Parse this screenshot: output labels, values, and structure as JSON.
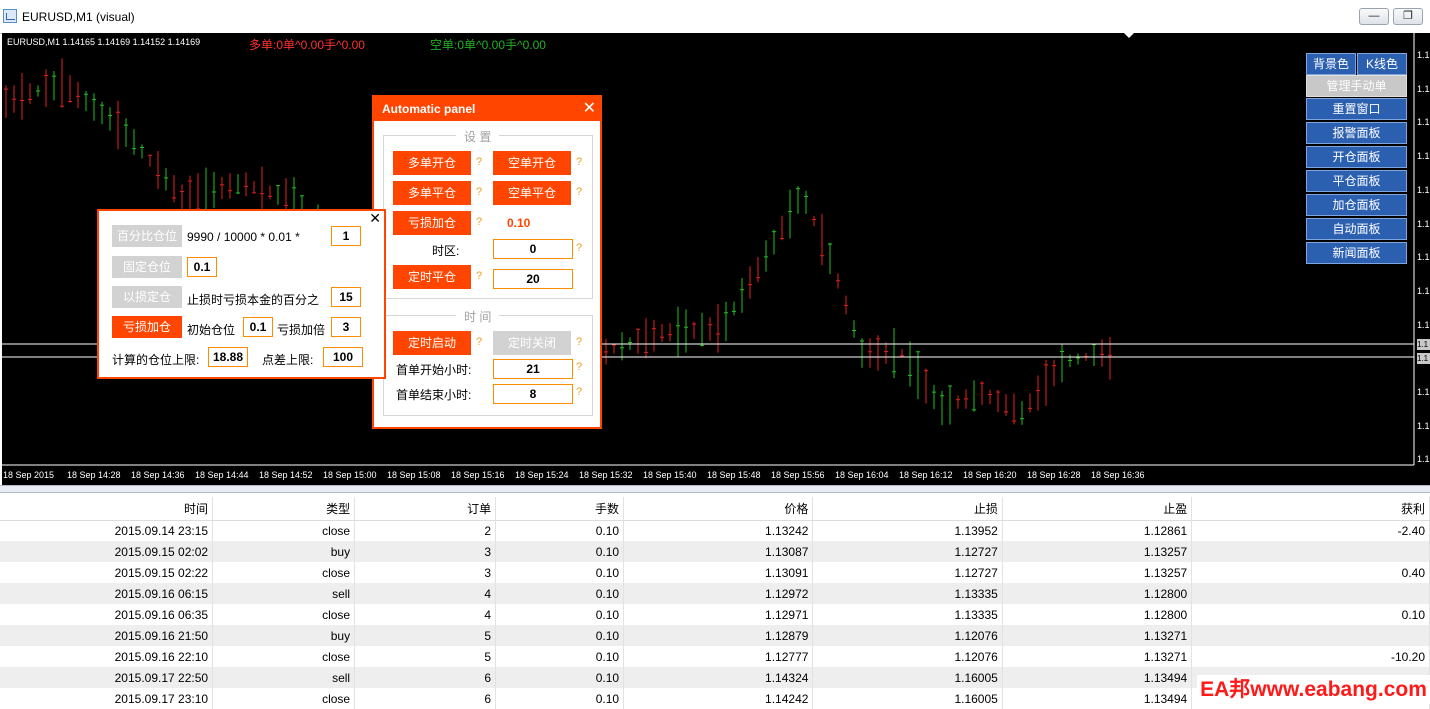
{
  "window": {
    "title": "EURUSD,M1 (visual)",
    "btn_minimize": "—",
    "btn_restore": "❐"
  },
  "chart": {
    "symbol_info": "EURUSD,M1  1.14165 1.14169 1.14152 1.14169",
    "long_info": "多单:0单^0.00手^0.00",
    "short_info": "空单:0单^0.00手^0.00",
    "price_labels": [
      "1.1",
      "1.1",
      "1.1",
      "1.1",
      "1.1",
      "1.1",
      "1.1",
      "1.1",
      "1.1",
      "1.1",
      "1.1",
      "1.1",
      "1.1",
      "1.1"
    ],
    "price_box_labels": [
      "1.1",
      "1.1"
    ],
    "time_labels": [
      "18 Sep 2015",
      "18 Sep 14:28",
      "18 Sep 14:36",
      "18 Sep 14:44",
      "18 Sep 14:52",
      "18 Sep 15:00",
      "18 Sep 15:08",
      "18 Sep 15:16",
      "18 Sep 15:24",
      "18 Sep 15:32",
      "18 Sep 15:40",
      "18 Sep 15:48",
      "18 Sep 15:56",
      "18 Sep 16:04",
      "18 Sep 16:12",
      "18 Sep 16:20",
      "18 Sep 16:28",
      "18 Sep 16:36"
    ],
    "colors": {
      "bull": "#22c022",
      "bear": "#e02020",
      "background": "#000000"
    }
  },
  "side_buttons": {
    "bg_color": "背景色",
    "k_color": "K线色",
    "items": [
      "管理手动单",
      "重置窗口",
      "报警面板",
      "开仓面板",
      "平仓面板",
      "加仓面板",
      "自动面板",
      "新闻面板"
    ]
  },
  "auto_panel": {
    "title": "Automatic panel",
    "close": "✕",
    "group_settings": "设 置",
    "group_time": "时 间",
    "btn_long_open": "多单开仓",
    "btn_short_open": "空单开仓",
    "btn_long_close": "多单平仓",
    "btn_short_close": "空单平仓",
    "btn_loss_add": "亏损加仓",
    "loss_add_value": "0.10",
    "timezone_label": "时区:",
    "timezone_value": "0",
    "btn_timed_close": "定时平仓",
    "timed_close_value": "20",
    "btn_timer_start": "定时启动",
    "btn_timer_stop": "定时关闭",
    "first_start_label": "首单开始小时:",
    "first_start_value": "21",
    "first_end_label": "首单结束小时:",
    "first_end_value": "8",
    "help": "?"
  },
  "lot_panel": {
    "close": "✕",
    "btn_percent": "百分比仓位",
    "percent_formula": "9990 / 10000 * 0.01 *",
    "percent_value": "1",
    "btn_fixed": "固定仓位",
    "fixed_value": "0.1",
    "btn_by_loss": "以损定仓",
    "by_loss_text": "止损时亏损本金的百分之",
    "by_loss_value": "15",
    "btn_loss_add": "亏损加仓",
    "initial_lot_label": "初始仓位",
    "initial_lot_value": "0.1",
    "multiplier_label": "亏损加倍",
    "multiplier_value": "3",
    "max_lot_label": "计算的仓位上限:",
    "max_lot_value": "18.88",
    "max_spread_label": "点差上限:",
    "max_spread_value": "100"
  },
  "table": {
    "headers": [
      "时间",
      "类型",
      "订单",
      "手数",
      "价格",
      "止损",
      "止盈",
      "获利"
    ],
    "rows": [
      [
        "2015.09.14 23:15",
        "close",
        "2",
        "0.10",
        "1.13242",
        "1.13952",
        "1.12861",
        "-2.40"
      ],
      [
        "2015.09.15 02:02",
        "buy",
        "3",
        "0.10",
        "1.13087",
        "1.12727",
        "1.13257",
        ""
      ],
      [
        "2015.09.15 02:22",
        "close",
        "3",
        "0.10",
        "1.13091",
        "1.12727",
        "1.13257",
        "0.40"
      ],
      [
        "2015.09.16 06:15",
        "sell",
        "4",
        "0.10",
        "1.12972",
        "1.13335",
        "1.12800",
        ""
      ],
      [
        "2015.09.16 06:35",
        "close",
        "4",
        "0.10",
        "1.12971",
        "1.13335",
        "1.12800",
        "0.10"
      ],
      [
        "2015.09.16 21:50",
        "buy",
        "5",
        "0.10",
        "1.12879",
        "1.12076",
        "1.13271",
        ""
      ],
      [
        "2015.09.16 22:10",
        "close",
        "5",
        "0.10",
        "1.12777",
        "1.12076",
        "1.13271",
        "-10.20"
      ],
      [
        "2015.09.17 22:50",
        "sell",
        "6",
        "0.10",
        "1.14324",
        "1.16005",
        "1.13494",
        ""
      ],
      [
        "2015.09.17 23:10",
        "close",
        "6",
        "0.10",
        "1.14242",
        "1.16005",
        "1.13494",
        "8.20"
      ]
    ]
  },
  "watermark": "EA邦www.eabang.com"
}
